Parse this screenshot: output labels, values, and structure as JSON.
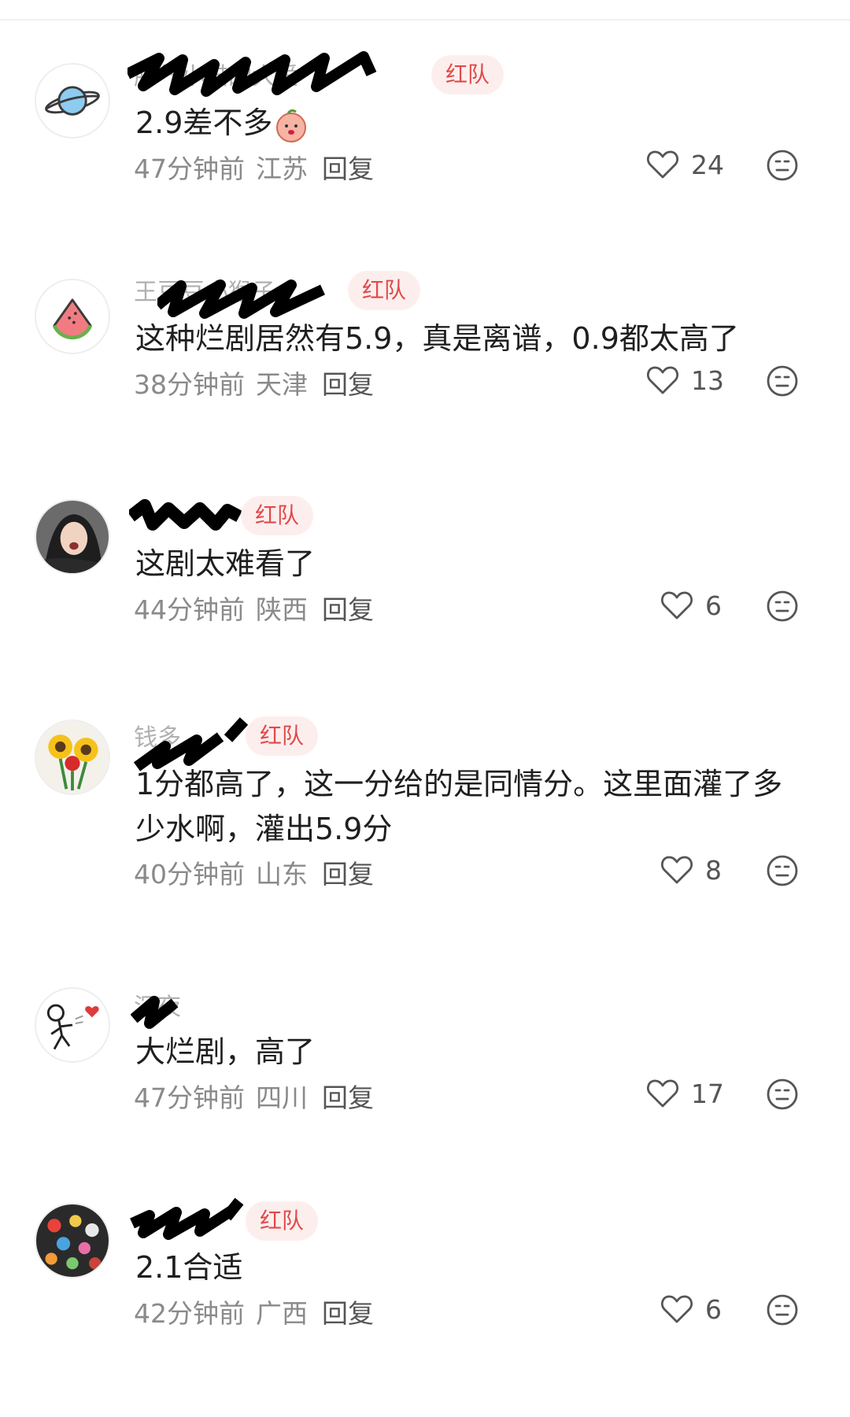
{
  "comments": [
    {
      "username": "脾气小猫的大爱",
      "badge": "红队",
      "text": "2.9差不多",
      "time": "47分钟前",
      "location": "江苏",
      "reply_label": "回复",
      "likes": "24",
      "avatar_icon": "planet-icon"
    },
    {
      "username": "王豆豆小猴子",
      "badge": "红队",
      "text": "这种烂剧居然有5.9，真是离谱，0.9都太高了",
      "time": "38分钟前",
      "location": "天津",
      "reply_label": "回复",
      "likes": "13",
      "avatar_icon": "watermelon-icon"
    },
    {
      "username": "",
      "badge": "红队",
      "text": "这剧太难看了",
      "time": "44分钟前",
      "location": "陕西",
      "reply_label": "回复",
      "likes": "6",
      "avatar_icon": "person-photo-avatar"
    },
    {
      "username": "钱多",
      "badge": "红队",
      "text": "1分都高了，这一分给的是同情分。这里面灌了多少水啊，灌出5.9分",
      "time": "40分钟前",
      "location": "山东",
      "reply_label": "回复",
      "likes": "8",
      "avatar_icon": "sunflower-icon"
    },
    {
      "username": "沉夜",
      "badge": "",
      "text": "大烂剧，高了",
      "time": "47分钟前",
      "location": "四川",
      "reply_label": "回复",
      "likes": "17",
      "avatar_icon": "stickman-heart-icon"
    },
    {
      "username": "",
      "badge": "红队",
      "text": "2.1合适",
      "time": "42分钟前",
      "location": "广西",
      "reply_label": "回复",
      "likes": "6",
      "avatar_icon": "flowers-icon"
    }
  ],
  "colors": {
    "badge_bg": "#fdeeee",
    "badge_text": "#e14a4a",
    "meta_text": "#8a8a8a",
    "body_text": "#1f1f1f"
  }
}
